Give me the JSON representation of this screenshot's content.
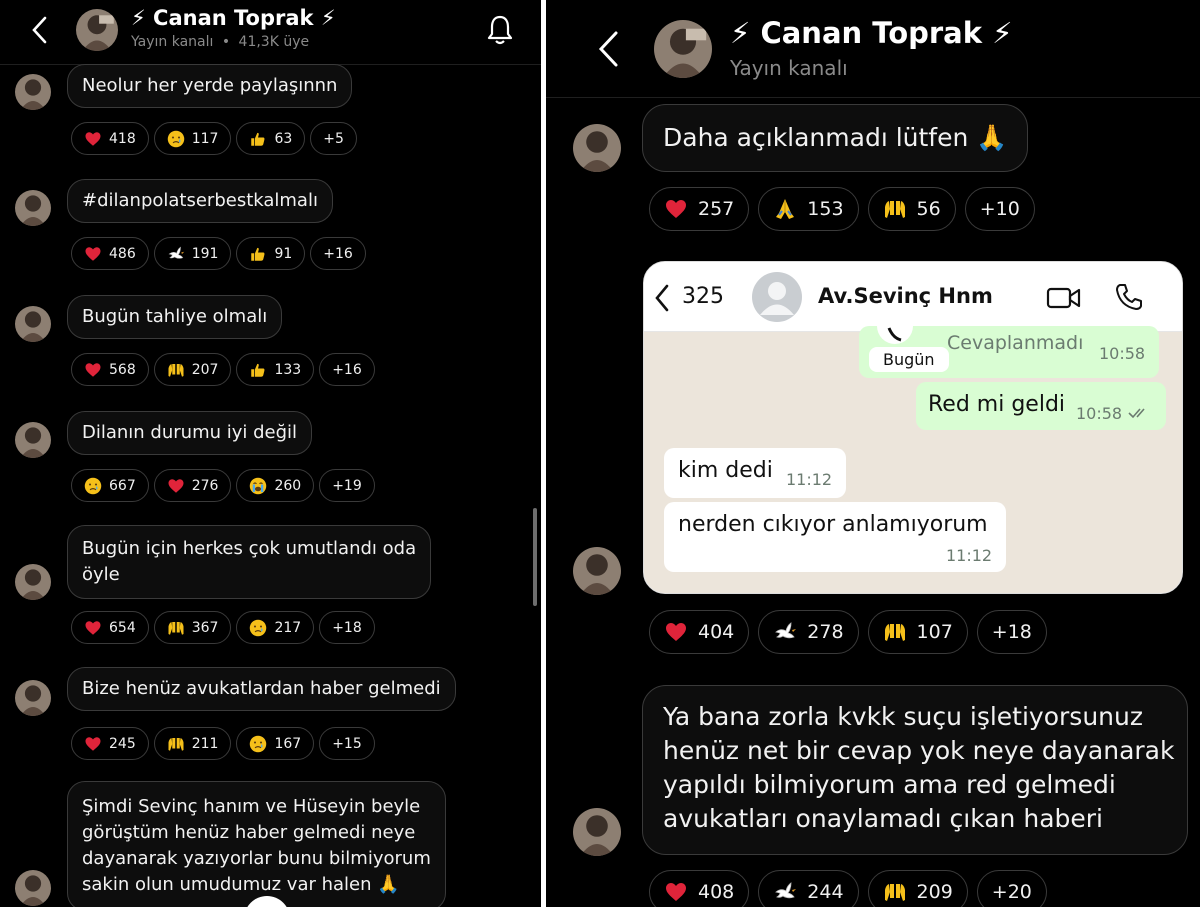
{
  "left": {
    "header": {
      "title": "⚡ Canan Toprak ⚡",
      "subtitle": "Yayın kanalı",
      "separator": "•",
      "members": "41,3K üye"
    },
    "messages": [
      {
        "lines": [
          "Neolur her yerde paylaşınnn"
        ],
        "reactions": [
          {
            "icon": "heart-icon",
            "count": "418"
          },
          {
            "icon": "crying-face-icon",
            "count": "117"
          },
          {
            "icon": "thumbs-up-icon",
            "count": "63"
          },
          {
            "icon": "",
            "count": "+5"
          }
        ]
      },
      {
        "lines": [
          "#dilanpolatserbestkalmalı"
        ],
        "reactions": [
          {
            "icon": "heart-icon",
            "count": "486"
          },
          {
            "icon": "dove-icon",
            "count": "191"
          },
          {
            "icon": "thumbs-up-icon",
            "count": "91"
          },
          {
            "icon": "",
            "count": "+16"
          }
        ]
      },
      {
        "lines": [
          "Bugün tahliye olmalı"
        ],
        "reactions": [
          {
            "icon": "heart-icon",
            "count": "568"
          },
          {
            "icon": "raised-hands-icon",
            "count": "207"
          },
          {
            "icon": "thumbs-up-icon",
            "count": "133"
          },
          {
            "icon": "",
            "count": "+16"
          }
        ]
      },
      {
        "lines": [
          "Dilanın durumu iyi değil"
        ],
        "reactions": [
          {
            "icon": "crying-face-icon",
            "count": "667"
          },
          {
            "icon": "heart-icon",
            "count": "276"
          },
          {
            "icon": "sobbing-face-icon",
            "count": "260"
          },
          {
            "icon": "",
            "count": "+19"
          }
        ]
      },
      {
        "lines": [
          "Bugün için herkes çok umutlandı oda",
          "öyle"
        ],
        "reactions": [
          {
            "icon": "heart-icon",
            "count": "654"
          },
          {
            "icon": "raised-hands-icon",
            "count": "367"
          },
          {
            "icon": "crying-face-icon",
            "count": "217"
          },
          {
            "icon": "",
            "count": "+18"
          }
        ]
      },
      {
        "lines": [
          "Bize henüz avukatlardan haber gelmedi"
        ],
        "reactions": [
          {
            "icon": "heart-icon",
            "count": "245"
          },
          {
            "icon": "raised-hands-icon",
            "count": "211"
          },
          {
            "icon": "crying-face-icon",
            "count": "167"
          },
          {
            "icon": "",
            "count": "+15"
          }
        ]
      },
      {
        "lines": [
          "Şimdi Sevinç hanım ve Hüseyin beyle",
          "görüştüm henüz haber gelmedi neye",
          "dayanarak yazıyorlar bunu bilmiyorum",
          "sakin olun umudumuz var halen 🙏"
        ],
        "reactions": []
      }
    ]
  },
  "right": {
    "header": {
      "title": "⚡ Canan Toprak ⚡",
      "subtitle": "Yayın kanalı"
    },
    "messages": [
      {
        "lines": [
          "Daha açıklanmadı lütfen 🙏"
        ],
        "reactions": [
          {
            "icon": "heart-icon",
            "count": "257"
          },
          {
            "icon": "folded-hands-icon",
            "count": "153"
          },
          {
            "icon": "raised-hands-icon",
            "count": "56"
          },
          {
            "icon": "",
            "count": "+10"
          }
        ]
      },
      {
        "lines": [],
        "reactions": [
          {
            "icon": "heart-icon",
            "count": "404"
          },
          {
            "icon": "dove-icon",
            "count": "278"
          },
          {
            "icon": "raised-hands-icon",
            "count": "107"
          },
          {
            "icon": "",
            "count": "+18"
          }
        ]
      },
      {
        "lines": [
          "Ya bana zorla kvkk suçu işletiyorsunuz",
          "henüz net bir cevap yok neye dayanarak",
          "yapıldı bilmiyorum ama red gelmedi",
          "avukatları onaylamadı çıkan haberi"
        ],
        "reactions": [
          {
            "icon": "heart-icon",
            "count": "408"
          },
          {
            "icon": "dove-icon",
            "count": "244"
          },
          {
            "icon": "raised-hands-icon",
            "count": "209"
          },
          {
            "icon": "",
            "count": "+20"
          }
        ]
      }
    ],
    "screenshot": {
      "back_count": "325",
      "contact": "Av.Sevinç Hnm",
      "missed_call": "Cevaplanmadı",
      "missed_time": "10:58",
      "date_chip": "Bugün",
      "out_text": "Red mi geldi",
      "out_time": "10:58",
      "in1_text": "kim dedi",
      "in1_time": "11:12",
      "in2_text": "nerden cıkıyor anlamıyorum",
      "in2_time": "11:12"
    }
  },
  "colors": {
    "heart": "#e0243a",
    "yellow": "#f5c01a",
    "chat_bg": "#ece5db",
    "bubble_out": "#d9fdd3"
  }
}
